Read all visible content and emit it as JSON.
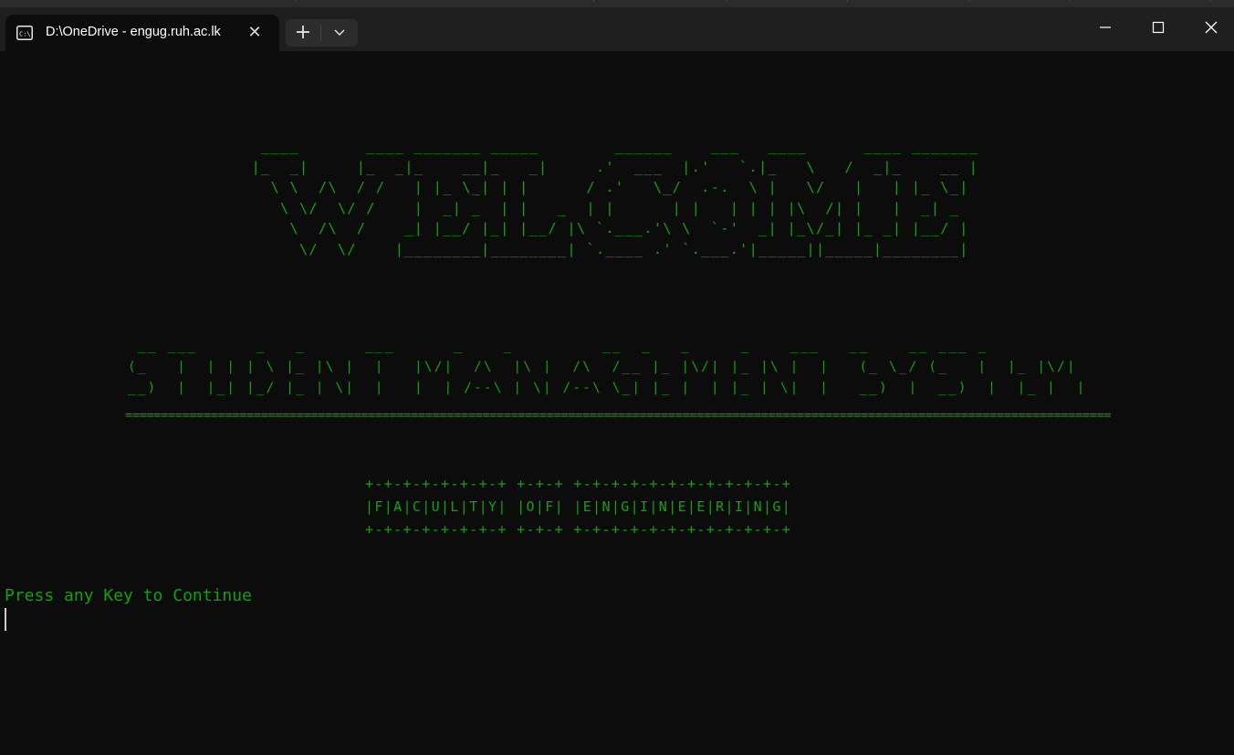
{
  "window": {
    "tab_title": "D:\\OneDrive - engug.ruh.ac.lk",
    "icons": {
      "tab": "terminal-icon",
      "close_tab": "close-icon",
      "new_tab": "plus-icon",
      "dropdown": "chevron-down-icon",
      "minimize": "minimize-icon",
      "maximize": "maximize-icon",
      "close": "close-icon"
    }
  },
  "terminal": {
    "welcome_banner": "  ____       ____ _______ _____        ______    ___   ____      ____ _______\n |_  _|     |_  _|_    __|_   _|     .'  ___  |.'   `.|_   \\   /  _|_    __ |\n   \\ \\  /\\  / /   | |_ \\_| | |      / .'   \\_/  .-.  \\ |   \\/   |   | |_ \\_|\n    \\ \\/  \\/ /    |  _| _  | |   _  | |      | |   | | | |\\  /| |   |  _| _\n     \\  /\\  /    _| |__/ |_| |__/ |\\ `.___.'\\ \\  `-'  _| |_\\/_| |_ _| |__/ |\n      \\/  \\/    |________|________| `.____ .' `.___.'|_____||_____|________|",
    "title_banner": " __ ___      _   _      ___      _    _         __  _   _     _    ___   __    __ ___ _\n(_   |  | | | \\ |_ |\\ |  |   |\\/|  /\\  |\\ |  /\\  /__ |_ |\\/| |_ |\\ |  |   (_ \\_/ (_   |  |_ |\\/|\n__)  |  |_| |_/ |_ | \\|  |   |  | /--\\ | \\| /--\\ \\_| |_ |  | |_ | \\|  |   __)  |  __)  |  |_ |  |",
    "separator": "============================================================================================================================================",
    "faculty_banner": "+-+-+-+-+-+-+-+ +-+-+ +-+-+-+-+-+-+-+-+-+-+-+\n|F|A|C|U|L|T|Y| |O|F| |E|N|G|I|N|E|E|R|I|N|G|\n+-+-+-+-+-+-+-+ +-+-+ +-+-+-+-+-+-+-+-+-+-+-+",
    "prompt": "Press any Key to Continue"
  },
  "colors": {
    "terminal_bg": "#0c0c0c",
    "terminal_fg": "#13a10e",
    "titlebar_bg": "#1f1f1f",
    "tab_bg": "#0c0c0c",
    "cursor": "#cccccc"
  }
}
